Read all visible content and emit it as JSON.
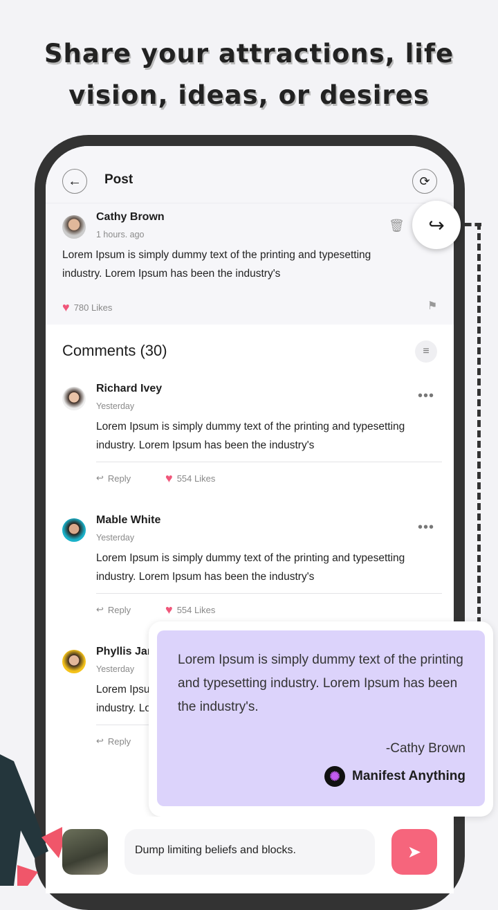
{
  "headline": {
    "line1": "Share your attractions, life",
    "line2": "vision, ideas, or desires"
  },
  "header": {
    "title": "Post",
    "back_icon": "arrow-left-icon",
    "refresh_icon": "refresh-icon"
  },
  "post": {
    "author": "Cathy Brown",
    "time": "1 hours. ago",
    "text": "Lorem Ipsum is simply dummy text of the printing and typesetting industry. Lorem Ipsum has been the industry's",
    "likes": "780 Likes"
  },
  "comments": {
    "heading": "Comments (30)",
    "reply_label": "Reply",
    "items": [
      {
        "name": "Richard Ivey",
        "time": "Yesterday",
        "text": "Lorem Ipsum is simply dummy text of the printing and typesetting industry. Lorem Ipsum has been the industry's",
        "likes": "554 Likes"
      },
      {
        "name": "Mable White",
        "time": "Yesterday",
        "text": "Lorem Ipsum is simply dummy text of the printing and typesetting industry. Lorem Ipsum has been the industry's",
        "likes": "554 Likes"
      },
      {
        "name": "Phyllis Jan",
        "time": "Yesterday",
        "text": "Lorem Ipsum is simply dummy text of the printing and typesetting industry. Lorem Ipsum has been the industry's",
        "likes": ""
      }
    ]
  },
  "quote_card": {
    "text": "Lorem Ipsum is simply dummy text of the printing and typesetting industry. Lorem Ipsum has been the industry's.",
    "author": "-Cathy Brown",
    "brand": "Manifest Anything"
  },
  "composer": {
    "value": "Dump limiting beliefs and blocks."
  },
  "colors": {
    "accent": "#f6657c",
    "quote_bg": "#dcd3fb",
    "frame": "#333333"
  }
}
